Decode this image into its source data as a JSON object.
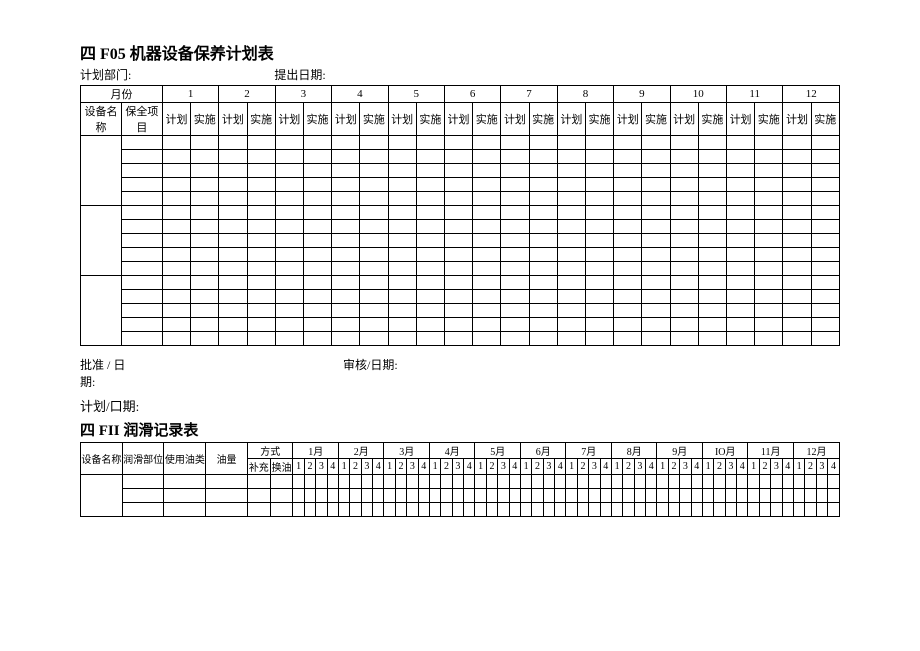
{
  "table1": {
    "title": "四 F05 机器设备保养计划表",
    "dept_label": "计划部门:",
    "date_label": "提出日期:",
    "month_label": "月份",
    "name_label": "设备名称",
    "item_label": "保全项目",
    "months": [
      "1",
      "2",
      "3",
      "4",
      "5",
      "6",
      "7",
      "8",
      "9",
      "10",
      "11",
      "12"
    ],
    "plan": "计划",
    "impl": "实施"
  },
  "approval": {
    "approve": "批准 / 日",
    "approve2": "期:",
    "review": "审核/日期:",
    "plan": "计划/口期:"
  },
  "table2": {
    "title": "四 FII 润滑记录表",
    "cols": [
      "设备名称",
      "润滑部位",
      "使用油类",
      "油量"
    ],
    "method": "方式",
    "method_sub": [
      "补充",
      "换油"
    ],
    "months": [
      "1月",
      "2月",
      "3月",
      "4月",
      "5月",
      "6月",
      "7月",
      "8月",
      "9月",
      "IO月",
      "11月",
      "12月"
    ],
    "subnums": [
      "1",
      "2",
      "3",
      "4"
    ]
  }
}
